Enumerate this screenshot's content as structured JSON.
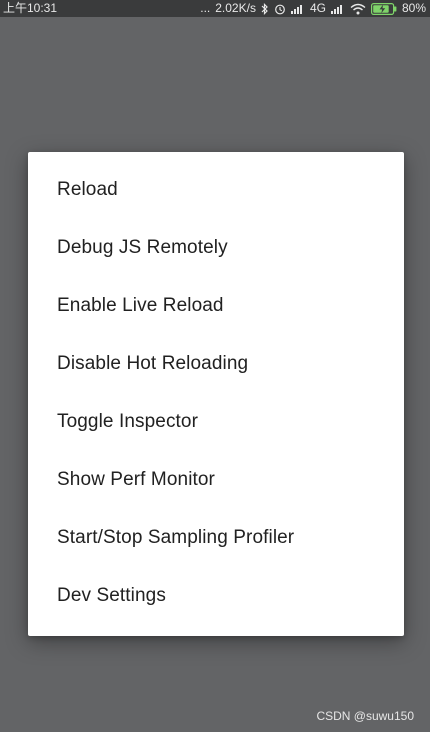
{
  "status_bar": {
    "time": "上午10:31",
    "dots": "...",
    "network_speed": "2.02K/s",
    "network_type": "4G",
    "battery_percent": "80%",
    "icons": [
      "bluetooth-icon",
      "alarm-icon",
      "signal-icon",
      "signal-icon",
      "wifi-icon",
      "battery-charging-icon"
    ]
  },
  "dev_menu": {
    "items": [
      {
        "label": "Reload"
      },
      {
        "label": "Debug JS Remotely"
      },
      {
        "label": "Enable Live Reload"
      },
      {
        "label": "Disable Hot Reloading"
      },
      {
        "label": "Toggle Inspector"
      },
      {
        "label": "Show Perf Monitor"
      },
      {
        "label": "Start/Stop Sampling Profiler"
      },
      {
        "label": "Dev Settings"
      }
    ]
  },
  "watermark": "CSDN @suwu150",
  "colors": {
    "scrim": "#636466",
    "status_bar_bg": "#3a3b3c",
    "dialog_bg": "#ffffff",
    "menu_text": "#212121"
  }
}
